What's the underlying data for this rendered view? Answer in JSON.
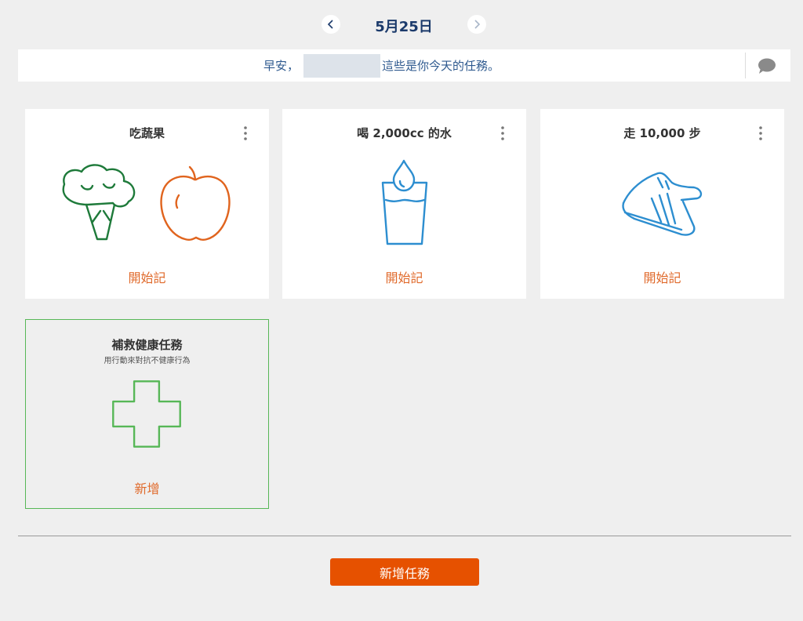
{
  "header": {
    "date_label": "5月25日"
  },
  "greeting": {
    "prefix": "早安，",
    "suffix": "這些是你今天的任務。"
  },
  "tasks": [
    {
      "title": "吃蔬果",
      "action": "開始記",
      "icon": "broccoli-apple-icon"
    },
    {
      "title": "喝 2,000cc 的水",
      "action": "開始記",
      "icon": "water-glass-icon"
    },
    {
      "title": "走 10,000 步",
      "action": "開始記",
      "icon": "sneaker-icon"
    }
  ],
  "remedy": {
    "title": "補救健康任務",
    "subtitle": "用行動來對抗不健康行為",
    "action": "新增",
    "icon": "plus-cross-icon"
  },
  "footer": {
    "add_task_label": "新增任務"
  },
  "colors": {
    "accent_orange": "#e65100",
    "link_orange": "#e06a2b",
    "title_navy": "#1b3a6b",
    "veg_green": "#1e7a3a",
    "apple_orange": "#e0641e",
    "water_blue": "#2d8ed0",
    "remedy_green": "#57b757"
  }
}
